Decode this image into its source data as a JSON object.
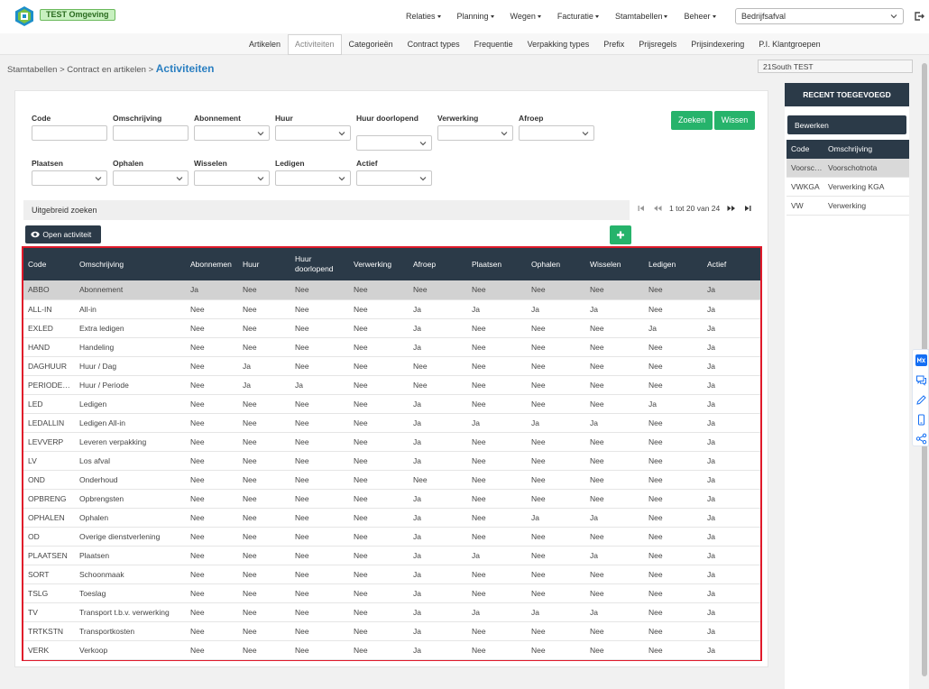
{
  "app": {
    "environment_badge": "TEST Omgeving",
    "org_select": "Bedrijfsafval"
  },
  "mainnav": [
    "Relaties",
    "Planning",
    "Wegen",
    "Facturatie",
    "Stamtabellen",
    "Beheer"
  ],
  "subnav": [
    "Artikelen",
    "Activiteiten",
    "Categorieën",
    "Contract types",
    "Frequentie",
    "Verpakking types",
    "Prefix",
    "Prijsregels",
    "Prijsindexering",
    "P.I. Klantgroepen"
  ],
  "subnav_active": "Activiteiten",
  "breadcrumb": {
    "path": "Stamtabellen > Contract en artikelen > ",
    "current": "Activiteiten"
  },
  "tenant": "21South TEST",
  "filters": {
    "code": "Code",
    "omschrijving": "Omschrijving",
    "abonnement": "Abonnement",
    "huur": "Huur",
    "huur_doorlopend": "Huur doorlopend",
    "verwerking": "Verwerking",
    "afroep": "Afroep",
    "plaatsen": "Plaatsen",
    "ophalen": "Ophalen",
    "wisselen": "Wisselen",
    "ledigen": "Ledigen",
    "actief": "Actief"
  },
  "buttons": {
    "search": "Zoeken",
    "clear": "Wissen",
    "open": "Open activiteit",
    "edit": "Bewerken"
  },
  "extended_search": "Uitgebreid zoeken",
  "pager": {
    "text": "1 tot 20 van 24"
  },
  "table": {
    "headers": [
      "Code",
      "Omschrijving",
      "Abonnemen",
      "Huur",
      "Huur doorlopend",
      "Verwerking",
      "Afroep",
      "Plaatsen",
      "Ophalen",
      "Wisselen",
      "Ledigen",
      "Actief"
    ],
    "rows": [
      [
        "ABBO",
        "Abonnement",
        "Ja",
        "Nee",
        "Nee",
        "Nee",
        "Nee",
        "Nee",
        "Nee",
        "Nee",
        "Nee",
        "Ja"
      ],
      [
        "ALL-IN",
        "All-in",
        "Nee",
        "Nee",
        "Nee",
        "Nee",
        "Ja",
        "Ja",
        "Ja",
        "Ja",
        "Nee",
        "Ja"
      ],
      [
        "EXLED",
        "Extra ledigen",
        "Nee",
        "Nee",
        "Nee",
        "Nee",
        "Ja",
        "Nee",
        "Nee",
        "Nee",
        "Ja",
        "Ja"
      ],
      [
        "HAND",
        "Handeling",
        "Nee",
        "Nee",
        "Nee",
        "Nee",
        "Ja",
        "Nee",
        "Nee",
        "Nee",
        "Nee",
        "Ja"
      ],
      [
        "DAGHUUR",
        "Huur / Dag",
        "Nee",
        "Ja",
        "Nee",
        "Nee",
        "Nee",
        "Nee",
        "Nee",
        "Nee",
        "Nee",
        "Ja"
      ],
      [
        "PERIODEHUUR",
        "Huur / Periode",
        "Nee",
        "Ja",
        "Ja",
        "Nee",
        "Nee",
        "Nee",
        "Nee",
        "Nee",
        "Nee",
        "Ja"
      ],
      [
        "LED",
        "Ledigen",
        "Nee",
        "Nee",
        "Nee",
        "Nee",
        "Ja",
        "Nee",
        "Nee",
        "Nee",
        "Ja",
        "Ja"
      ],
      [
        "LEDALLIN",
        "Ledigen All-in",
        "Nee",
        "Nee",
        "Nee",
        "Nee",
        "Ja",
        "Ja",
        "Ja",
        "Ja",
        "Nee",
        "Ja"
      ],
      [
        "LEVVERP",
        "Leveren verpakking",
        "Nee",
        "Nee",
        "Nee",
        "Nee",
        "Ja",
        "Nee",
        "Nee",
        "Nee",
        "Nee",
        "Ja"
      ],
      [
        "LV",
        "Los afval",
        "Nee",
        "Nee",
        "Nee",
        "Nee",
        "Ja",
        "Nee",
        "Nee",
        "Nee",
        "Nee",
        "Ja"
      ],
      [
        "OND",
        "Onderhoud",
        "Nee",
        "Nee",
        "Nee",
        "Nee",
        "Nee",
        "Nee",
        "Nee",
        "Nee",
        "Nee",
        "Ja"
      ],
      [
        "OPBRENG",
        "Opbrengsten",
        "Nee",
        "Nee",
        "Nee",
        "Nee",
        "Ja",
        "Nee",
        "Nee",
        "Nee",
        "Nee",
        "Ja"
      ],
      [
        "OPHALEN",
        "Ophalen",
        "Nee",
        "Nee",
        "Nee",
        "Nee",
        "Ja",
        "Nee",
        "Ja",
        "Ja",
        "Nee",
        "Ja"
      ],
      [
        "OD",
        "Overige dienstverlening",
        "Nee",
        "Nee",
        "Nee",
        "Nee",
        "Ja",
        "Nee",
        "Nee",
        "Nee",
        "Nee",
        "Ja"
      ],
      [
        "PLAATSEN",
        "Plaatsen",
        "Nee",
        "Nee",
        "Nee",
        "Nee",
        "Ja",
        "Ja",
        "Nee",
        "Ja",
        "Nee",
        "Ja"
      ],
      [
        "SORT",
        "Schoonmaak",
        "Nee",
        "Nee",
        "Nee",
        "Nee",
        "Ja",
        "Nee",
        "Nee",
        "Nee",
        "Nee",
        "Ja"
      ],
      [
        "TSLG",
        "Toeslag",
        "Nee",
        "Nee",
        "Nee",
        "Nee",
        "Ja",
        "Nee",
        "Nee",
        "Nee",
        "Nee",
        "Ja"
      ],
      [
        "TV",
        "Transport t.b.v. verwerking",
        "Nee",
        "Nee",
        "Nee",
        "Nee",
        "Ja",
        "Ja",
        "Ja",
        "Ja",
        "Nee",
        "Ja"
      ],
      [
        "TRTKSTN",
        "Transportkosten",
        "Nee",
        "Nee",
        "Nee",
        "Nee",
        "Ja",
        "Nee",
        "Nee",
        "Nee",
        "Nee",
        "Ja"
      ],
      [
        "VERK",
        "Verkoop",
        "Nee",
        "Nee",
        "Nee",
        "Nee",
        "Ja",
        "Nee",
        "Nee",
        "Nee",
        "Nee",
        "Ja"
      ]
    ]
  },
  "recent": {
    "title": "RECENT TOEGEVOEGD",
    "headers": [
      "Code",
      "Omschrijving"
    ],
    "rows": [
      [
        "Voorschotnota",
        "Voorschotnota"
      ],
      [
        "VWKGA",
        "Verwerking KGA"
      ],
      [
        "VW",
        "Verwerking"
      ]
    ]
  },
  "colors": {
    "accent_green": "#26b36b",
    "header_dark": "#2b3a48",
    "highlight_border": "#e0192a",
    "link_blue": "#2a7fc1"
  }
}
